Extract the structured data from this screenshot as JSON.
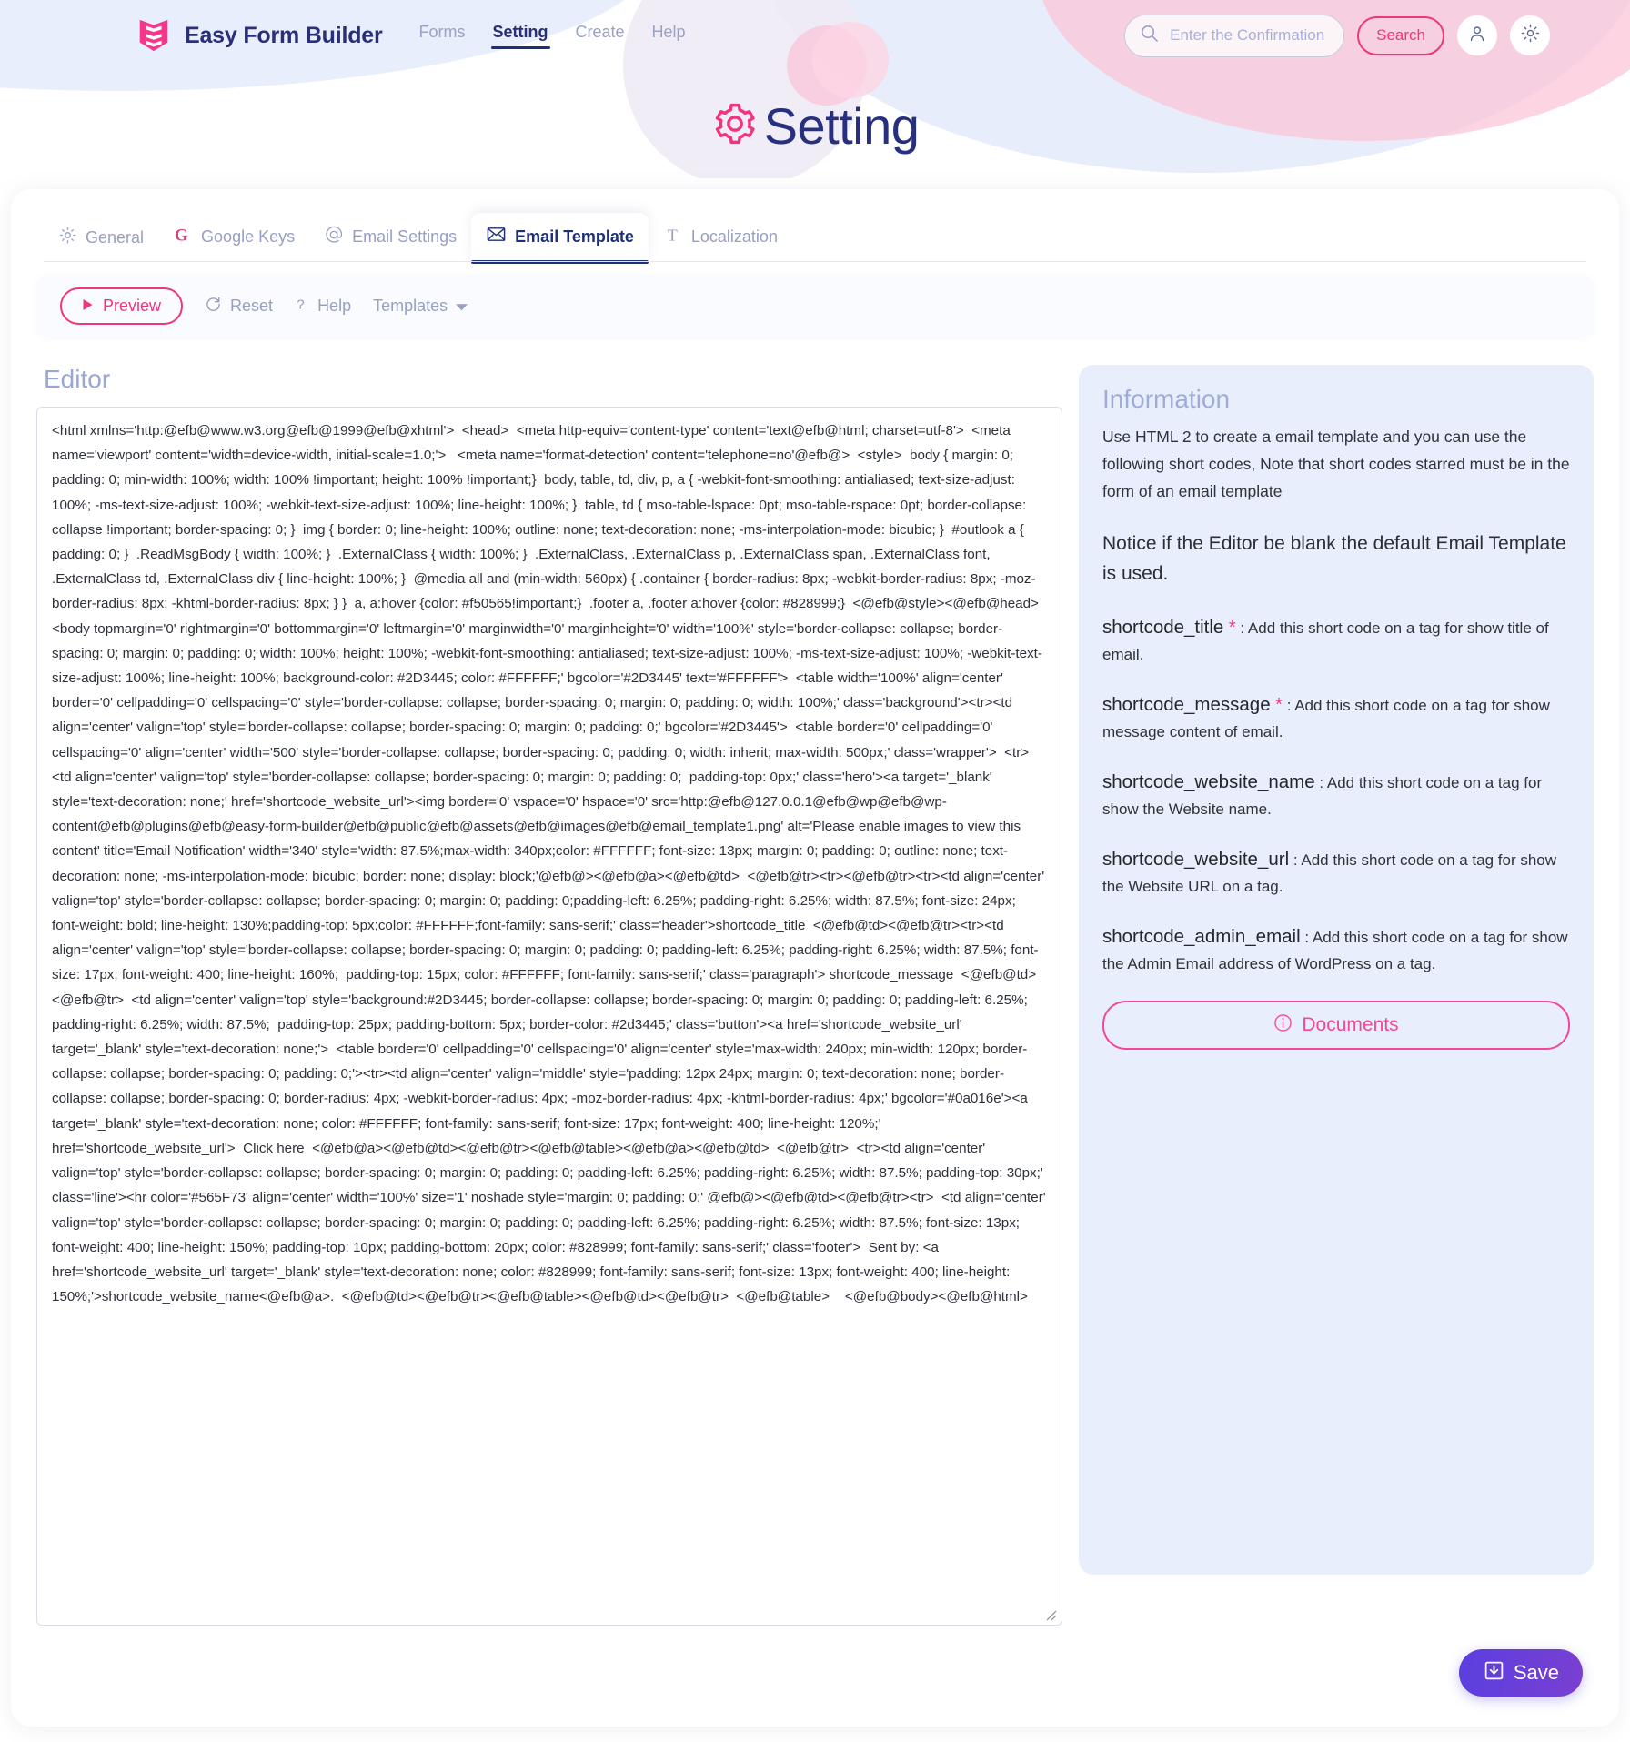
{
  "brand": {
    "name": "Easy Form Builder",
    "logo_icon": "efb-logo-icon"
  },
  "nav": {
    "links": [
      {
        "label": "Forms",
        "active": false
      },
      {
        "label": "Setting",
        "active": true
      },
      {
        "label": "Create",
        "active": false
      },
      {
        "label": "Help",
        "active": false
      }
    ]
  },
  "search": {
    "placeholder": "Enter the Confirmation Code",
    "value": "",
    "icon": "search-icon",
    "button_label": "Search"
  },
  "header_icons": {
    "account": "user-icon",
    "settings": "gear-icon"
  },
  "page": {
    "title": "Setting",
    "title_icon": "gear-icon"
  },
  "tabs": [
    {
      "label": "General",
      "icon": "gear-icon",
      "active": false
    },
    {
      "label": "Google Keys",
      "icon": "google-g-icon",
      "active": false
    },
    {
      "label": "Email Settings",
      "icon": "at-sign-icon",
      "active": false
    },
    {
      "label": "Email Template",
      "icon": "envelope-icon",
      "active": true
    },
    {
      "label": "Localization",
      "icon": "text-t-icon",
      "active": false
    }
  ],
  "toolbar": {
    "preview_label": "Preview",
    "preview_icon": "play-icon",
    "reset_label": "Reset",
    "reset_icon": "refresh-icon",
    "help_label": "Help",
    "help_icon": "question-mark-icon",
    "templates_label": "Templates",
    "templates_icon": "chevron-down-icon"
  },
  "editor": {
    "title": "Editor",
    "code": "<html xmlns='http:@efb@www.w3.org@efb@1999@efb@xhtml'>  <head>  <meta http-equiv='content-type' content='text@efb@html; charset=utf-8'>  <meta name='viewport' content='width=device-width, initial-scale=1.0;'>   <meta name='format-detection' content='telephone=no'@efb@>  <style>  body { margin: 0; padding: 0; min-width: 100%; width: 100% !important; height: 100% !important;}  body, table, td, div, p, a { -webkit-font-smoothing: antialiased; text-size-adjust: 100%; -ms-text-size-adjust: 100%; -webkit-text-size-adjust: 100%; line-height: 100%; }  table, td { mso-table-lspace: 0pt; mso-table-rspace: 0pt; border-collapse: collapse !important; border-spacing: 0; }  img { border: 0; line-height: 100%; outline: none; text-decoration: none; -ms-interpolation-mode: bicubic; }  #outlook a { padding: 0; }  .ReadMsgBody { width: 100%; }  .ExternalClass { width: 100%; }  .ExternalClass, .ExternalClass p, .ExternalClass span, .ExternalClass font, .ExternalClass td, .ExternalClass div { line-height: 100%; }  @media all and (min-width: 560px) { .container { border-radius: 8px; -webkit-border-radius: 8px; -moz-border-radius: 8px; -khtml-border-radius: 8px; } }  a, a:hover {color: #f50565!important;}  .footer a, .footer a:hover {color: #828999;}  <@efb@style><@efb@head>  <body topmargin='0' rightmargin='0' bottommargin='0' leftmargin='0' marginwidth='0' marginheight='0' width='100%' style='border-collapse: collapse; border-spacing: 0; margin: 0; padding: 0; width: 100%; height: 100%; -webkit-font-smoothing: antialiased; text-size-adjust: 100%; -ms-text-size-adjust: 100%; -webkit-text-size-adjust: 100%; line-height: 100%; background-color: #2D3445; color: #FFFFFF;' bgcolor='#2D3445' text='#FFFFFF'>  <table width='100%' align='center' border='0' cellpadding='0' cellspacing='0' style='border-collapse: collapse; border-spacing: 0; margin: 0; padding: 0; width: 100%;' class='background'><tr><td align='center' valign='top' style='border-collapse: collapse; border-spacing: 0; margin: 0; padding: 0;' bgcolor='#2D3445'>  <table border='0' cellpadding='0' cellspacing='0' align='center' width='500' style='border-collapse: collapse; border-spacing: 0; padding: 0; width: inherit; max-width: 500px;' class='wrapper'>  <tr>  <td align='center' valign='top' style='border-collapse: collapse; border-spacing: 0; margin: 0; padding: 0;  padding-top: 0px;' class='hero'><a target='_blank' style='text-decoration: none;' href='shortcode_website_url'><img border='0' vspace='0' hspace='0' src='http:@efb@127.0.0.1@efb@wp@efb@wp-content@efb@plugins@efb@easy-form-builder@efb@public@efb@assets@efb@images@efb@email_template1.png' alt='Please enable images to view this content' title='Email Notification' width='340' style='width: 87.5%;max-width: 340px;color: #FFFFFF; font-size: 13px; margin: 0; padding: 0; outline: none; text-decoration: none; -ms-interpolation-mode: bicubic; border: none; display: block;'@efb@><@efb@a><@efb@td>  <@efb@tr><tr><@efb@tr><tr><td align='center' valign='top' style='border-collapse: collapse; border-spacing: 0; margin: 0; padding: 0;padding-left: 6.25%; padding-right: 6.25%; width: 87.5%; font-size: 24px; font-weight: bold; line-height: 130%;padding-top: 5px;color: #FFFFFF;font-family: sans-serif;' class='header'>shortcode_title  <@efb@td><@efb@tr><tr><td align='center' valign='top' style='border-collapse: collapse; border-spacing: 0; margin: 0; padding: 0; padding-left: 6.25%; padding-right: 6.25%; width: 87.5%; font-size: 17px; font-weight: 400; line-height: 160%;  padding-top: 15px; color: #FFFFFF; font-family: sans-serif;' class='paragraph'> shortcode_message  <@efb@td><@efb@tr>  <td align='center' valign='top' style='background:#2D3445; border-collapse: collapse; border-spacing: 0; margin: 0; padding: 0; padding-left: 6.25%; padding-right: 6.25%; width: 87.5%;  padding-top: 25px; padding-bottom: 5px; border-color: #2d3445;' class='button'><a href='shortcode_website_url' target='_blank' style='text-decoration: none;'>  <table border='0' cellpadding='0' cellspacing='0' align='center' style='max-width: 240px; min-width: 120px; border-collapse: collapse; border-spacing: 0; padding: 0;'><tr><td align='center' valign='middle' style='padding: 12px 24px; margin: 0; text-decoration: none; border-collapse: collapse; border-spacing: 0; border-radius: 4px; -webkit-border-radius: 4px; -moz-border-radius: 4px; -khtml-border-radius: 4px;' bgcolor='#0a016e'><a target='_blank' style='text-decoration: none; color: #FFFFFF; font-family: sans-serif; font-size: 17px; font-weight: 400; line-height: 120%;' href='shortcode_website_url'>  Click here  <@efb@a><@efb@td><@efb@tr><@efb@table><@efb@a><@efb@td>  <@efb@tr>  <tr><td align='center' valign='top' style='border-collapse: collapse; border-spacing: 0; margin: 0; padding: 0; padding-left: 6.25%; padding-right: 6.25%; width: 87.5%; padding-top: 30px;' class='line'><hr color='#565F73' align='center' width='100%' size='1' noshade style='margin: 0; padding: 0;' @efb@><@efb@td><@efb@tr><tr>  <td align='center' valign='top' style='border-collapse: collapse; border-spacing: 0; margin: 0; padding: 0; padding-left: 6.25%; padding-right: 6.25%; width: 87.5%; font-size: 13px; font-weight: 400; line-height: 150%; padding-top: 10px; padding-bottom: 20px; color: #828999; font-family: sans-serif;' class='footer'>  Sent by: <a href='shortcode_website_url' target='_blank' style='text-decoration: none; color: #828999; font-family: sans-serif; font-size: 13px; font-weight: 400; line-height: 150%;'>shortcode_website_name<@efb@a>.  <@efb@td><@efb@tr><@efb@table><@efb@td><@efb@tr>  <@efb@table>    <@efb@body><@efb@html>"
  },
  "information": {
    "title": "Information",
    "intro": "Use HTML 2 to create a email template and you can use the following short codes, Note that short codes starred must be in the form of an email template",
    "notice": "Notice if the Editor be blank the default Email Template is used.",
    "shortcodes": [
      {
        "name": "shortcode_title",
        "required": true,
        "desc": ": Add this short code on a tag for show title of email."
      },
      {
        "name": "shortcode_message",
        "required": true,
        "desc": ": Add this short code on a tag for show message content of email."
      },
      {
        "name": "shortcode_website_name",
        "required": false,
        "desc": ": Add this short code on a tag for show the Website name."
      },
      {
        "name": "shortcode_website_url",
        "required": false,
        "desc": ": Add this short code on a tag for show the Website URL on a tag."
      },
      {
        "name": "shortcode_admin_email",
        "required": false,
        "desc": ": Add this short code on a tag for show the Admin Email address of WordPress on a tag."
      }
    ],
    "documents_label": "Documents",
    "documents_icon": "info-circle-icon"
  },
  "footer": {
    "save_label": "Save",
    "save_icon": "save-download-icon"
  },
  "colors": {
    "accent_pink": "#f0357f",
    "brand_navy": "#27307e",
    "muted": "#97a0c1",
    "info_bg": "#e8eefb",
    "save_purple": "#5b3fe0"
  }
}
